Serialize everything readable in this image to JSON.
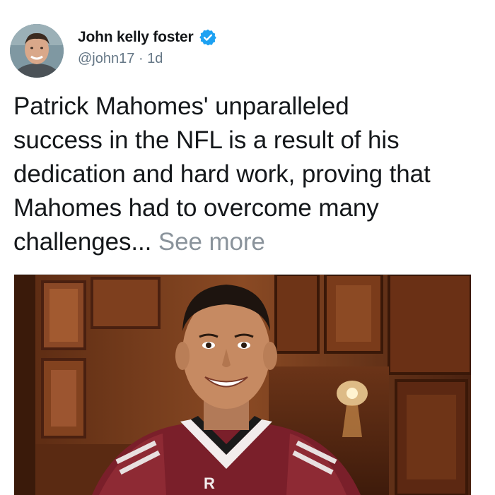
{
  "tweet": {
    "author": {
      "display_name": "John kelly foster",
      "handle": "@john17",
      "separator": "·",
      "time_ago": "1d",
      "verified": true,
      "verified_icon": "verified-badge-icon",
      "verified_color": "#1da1f2"
    },
    "text_lines": [
      "Patrick Mahomes' unparalleled",
      "success in the NFL is a result of his",
      "dedication and hard work, proving that",
      "Mahomes had to overcome many",
      "challenges..."
    ],
    "see_more_label": "See more",
    "media": {
      "description_icon": "photo",
      "jersey_letter": "R"
    }
  }
}
